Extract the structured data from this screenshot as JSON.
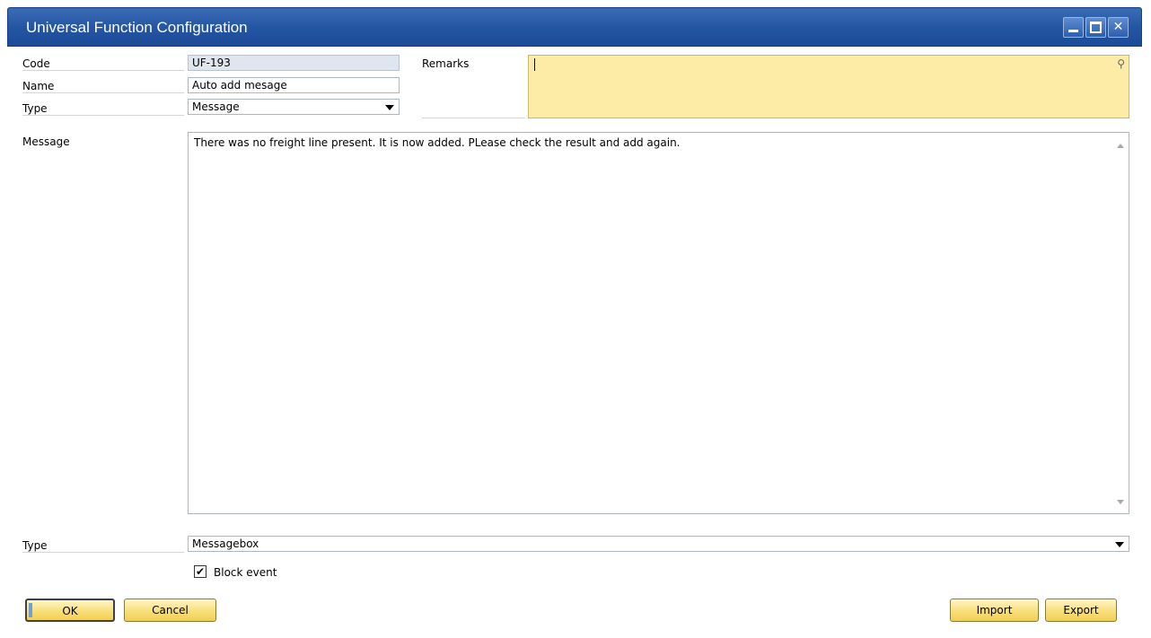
{
  "window": {
    "title": "Universal Function Configuration"
  },
  "header": {
    "code_label": "Code",
    "code_value": "UF-193",
    "name_label": "Name",
    "name_value": "Auto add mesage",
    "type_label": "Type",
    "type_value": "Message",
    "remarks_label": "Remarks",
    "remarks_value": ""
  },
  "message": {
    "label": "Message",
    "text": "There was no freight line present. It is now added. PLease check the result and add again."
  },
  "output": {
    "type_label": "Type",
    "type_value": "Messagebox",
    "block_event_label": "Block event",
    "block_event_checked": true,
    "check_glyph": "✔"
  },
  "buttons": {
    "ok": "OK",
    "cancel": "Cancel",
    "import": "Import",
    "export": "Export"
  },
  "icons": {
    "close_glyph": "✕",
    "globe_glyph": "⚲"
  },
  "colors": {
    "titlebar": "#2456a3",
    "remarks_bg": "#fdeca6",
    "button_gold": "#f8df7a",
    "readonly_bg": "#dfe6ee"
  }
}
